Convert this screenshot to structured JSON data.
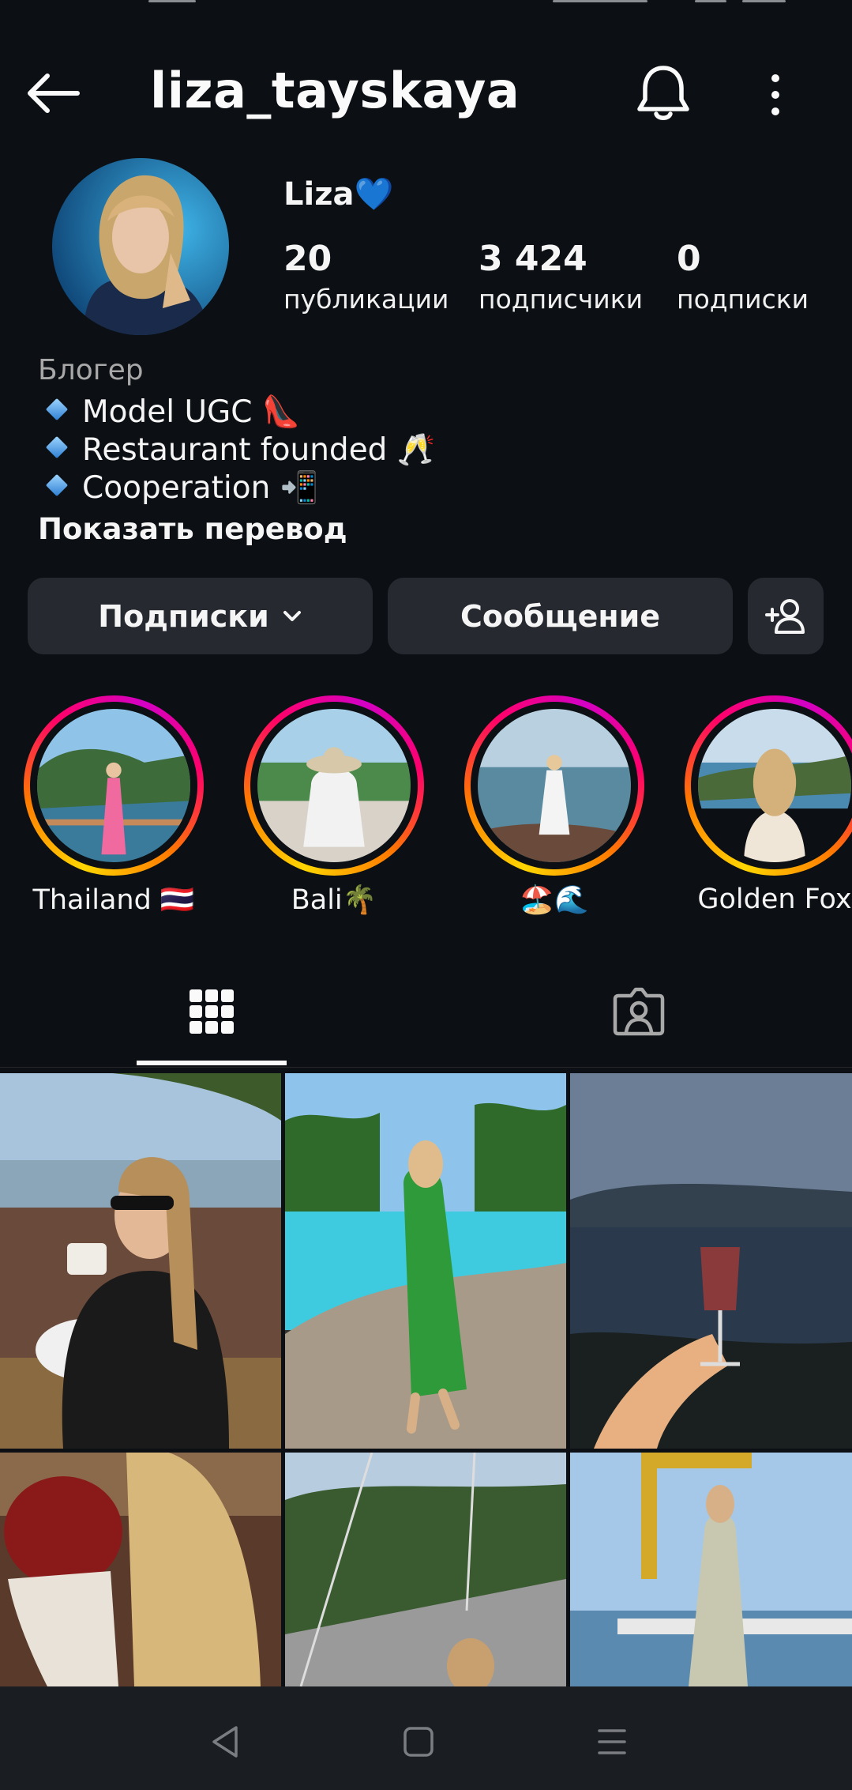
{
  "header": {
    "username": "liza_tayskaya"
  },
  "profile": {
    "display_name": "Liza💙",
    "stats": {
      "posts": {
        "count": "20",
        "label": "публикации"
      },
      "followers": {
        "count": "3 424",
        "label": "подписчики"
      },
      "following": {
        "count": "0",
        "label": "подписки"
      }
    },
    "category": "Блогер",
    "bio": [
      "Model UGC 👠",
      "Restaurant founded 🥂",
      "Cooperation 📲"
    ],
    "show_translation": "Показать перевод"
  },
  "actions": {
    "following_label": "Подписки",
    "message_label": "Сообщение"
  },
  "highlights": [
    {
      "label": "Thailand 🇹🇭"
    },
    {
      "label": "Bali🌴"
    },
    {
      "label": "🏖️🌊"
    },
    {
      "label": "Golden Fox"
    }
  ],
  "tabs": [
    {
      "icon": "grid-icon",
      "active": true
    },
    {
      "icon": "tagged-icon",
      "active": false
    }
  ],
  "icons": {
    "back": "back-arrow-icon",
    "bell": "bell-icon",
    "more": "more-vertical-icon",
    "chevron": "chevron-down-icon",
    "add_user": "add-user-icon",
    "nav_back": "nav-back-icon",
    "nav_home": "nav-home-icon",
    "nav_menu": "nav-menu-icon"
  },
  "colors": {
    "background": "#0c1014",
    "button": "#262a30",
    "text": "#f5f5f5",
    "secondary_text": "#a8a8a8",
    "ring_start": "#ffd600",
    "ring_end": "#d300c5"
  }
}
